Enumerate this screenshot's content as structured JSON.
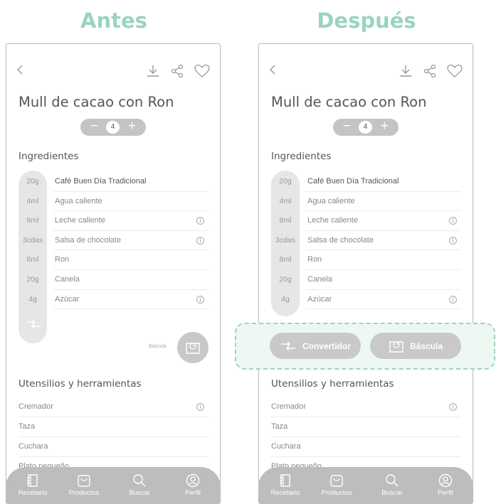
{
  "headings": {
    "before": "Antes",
    "after": "Después"
  },
  "recipe": {
    "title": "Mull de cacao con Ron",
    "servings": "4",
    "minus": "−",
    "plus": "+"
  },
  "ingredients_title": "Ingredientes",
  "ingredients": [
    {
      "qty": "20g",
      "name": "Café Buen Día Tradicional",
      "info": false
    },
    {
      "qty": "4ml",
      "name": "Agua caliente",
      "info": false
    },
    {
      "qty": "8ml",
      "name": "Leche caliente",
      "info": true
    },
    {
      "qty": "3cdas",
      "name": "Salsa de chocolate",
      "info": true
    },
    {
      "qty": "8ml",
      "name": "Ron",
      "info": false
    },
    {
      "qty": "20g",
      "name": "Canela",
      "info": false
    },
    {
      "qty": "4g",
      "name": "Azúcar",
      "info": true
    }
  ],
  "info_glyph": "i",
  "bascula_small_label": "Báscula",
  "tools_title": "Utensilios y herramientas",
  "tools": [
    {
      "name": "Cremador",
      "info": true
    },
    {
      "name": "Taza",
      "info": false
    },
    {
      "name": "Cuchara",
      "info": false
    },
    {
      "name": "Plato pequeño",
      "info": false
    }
  ],
  "actions": {
    "convertidor": "Convertidor",
    "bascula": "Báscula"
  },
  "nav": [
    {
      "label": "Recetario",
      "icon": "book-icon"
    },
    {
      "label": "Productos",
      "icon": "bag-icon"
    },
    {
      "label": "Buscar",
      "icon": "search-icon"
    },
    {
      "label": "Perfil",
      "icon": "profile-icon"
    }
  ],
  "colors": {
    "accent": "#9bd4bd",
    "highlight_bg": "#eef8f3",
    "pill": "#c4c4c4",
    "nav": "#bdbdbd"
  }
}
